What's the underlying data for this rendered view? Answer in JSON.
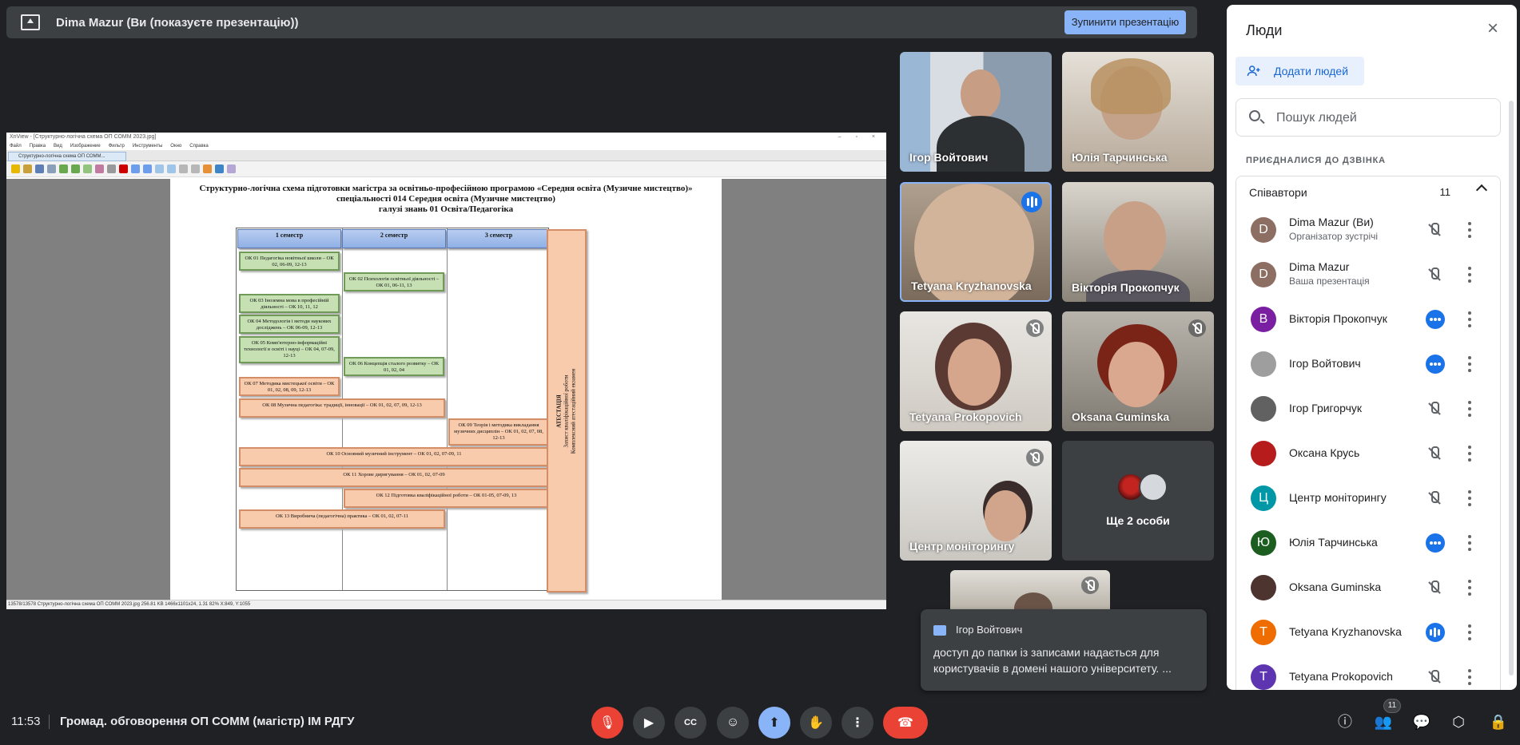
{
  "presenting_bar": {
    "title": "Dima Mazur (Ви (показуєте презентацію))",
    "stop_button": "Зупинити презентацію"
  },
  "shared_screen": {
    "window_title": "XnView - [Структурно-логічна схема ОП СОММ 2023.jpg]",
    "menu": [
      "Файл",
      "Правка",
      "Вид",
      "Изображение",
      "Фильтр",
      "Инструменты",
      "Окно",
      "Справка"
    ],
    "tab_label": "Структурно-логічна схема ОП СОММ...",
    "status": "13578/13578   Структурно-логічна схема ОП СОММ 2023.jpg   256.81 KB   1466x1101x24, 1.31   82%   X:849, Y:1055",
    "doc_title_lines": [
      "Структурно-логічна схема підготовки магістра за освітньо-професійною програмою «Середня освіта (Музичне мистецтво)»",
      "спеціальності 014 Середня освіта (Музичне мистецтво)",
      "галузі знань 01 Освіта/Педагогіка"
    ],
    "semesters": [
      "1 семестр",
      "2 семестр",
      "3 семестр"
    ],
    "boxes": [
      {
        "text": "ОК 01 Педагогіка новітньої школи – ОК 02, 06-09, 12-13",
        "color": "g"
      },
      {
        "text": "ОК 02 Психологія освітньої діяльності – ОК 01, 06-11, 13",
        "color": "g"
      },
      {
        "text": "ОК 03 Іноземна мова в професійній діяльності – ОК 10, 11, 12",
        "color": "g"
      },
      {
        "text": "ОК 04 Методологія і методи наукових досліджень – ОК 06-09, 12-13",
        "color": "g"
      },
      {
        "text": "ОК 05 Комп'ютерно-інформаційні технології в освіті і науці – ОК 04, 07-09, 12-13",
        "color": "g"
      },
      {
        "text": "ОК 06 Концепція сталого розвитку – ОК 01, 02, 04",
        "color": "g"
      },
      {
        "text": "ОК 07 Методика мистецької освіти – ОК 01, 02, 08, 09, 12-13",
        "color": "o"
      },
      {
        "text": "ОК 08 Музична педагогіка: традиції, інновації – ОК 01, 02, 07, 09, 12-13",
        "color": "o"
      },
      {
        "text": "ОК 09 Теорія і методика викладання музичних дисциплін – ОК 01, 02, 07, 08, 12-13",
        "color": "o"
      },
      {
        "text": "ОК 10 Основний музичний інструмент – ОК 01, 02, 07-09, 11",
        "color": "o"
      },
      {
        "text": "ОК 11 Хорове диригування – ОК 01, 02, 07-09",
        "color": "o"
      },
      {
        "text": "ОК 12 Підготовка кваліфікаційної роботи – ОК 01-05, 07-09, 13",
        "color": "o"
      },
      {
        "text": "ОК 13 Виробнича (педагогічна) практика – ОК 01, 02, 07-11",
        "color": "o"
      }
    ],
    "attestation": [
      "АТЕСТАЦІЯ",
      "Захист кваліфікаційної роботи",
      "Комплексний атестаційний екзамен"
    ]
  },
  "tiles": [
    {
      "name": "Ігор Войтович",
      "status": "none"
    },
    {
      "name": "Юлія Тарчинська",
      "status": "none"
    },
    {
      "name": "Tetyana Kryzhanovska",
      "status": "speaking"
    },
    {
      "name": "Вікторія Прокопчук",
      "status": "none"
    },
    {
      "name": "Tetyana Prokopovich",
      "status": "muted"
    },
    {
      "name": "Oksana Guminska",
      "status": "muted"
    },
    {
      "name": "Центр моніторингу",
      "status": "muted"
    },
    {
      "name": "Ще 2 особи",
      "status": "more"
    }
  ],
  "chat_toast": {
    "sender": "Ігор Войтович",
    "message": "доступ до папки із записами надається для користувачів в домені нашого університету. ..."
  },
  "bottom_bar": {
    "time": "11:53",
    "meeting_name": "Громад. обговорення ОП СОММ (магістр) ІМ РДГУ",
    "people_count": "11"
  },
  "people_panel": {
    "title": "Люди",
    "add_people": "Додати людей",
    "search_placeholder": "Пошук людей",
    "section_label": "ПРИЄДНАЛИСЯ ДО ДЗВІНКА",
    "group_name": "Співавтори",
    "group_count": "11",
    "participants": [
      {
        "initial": "D",
        "name": "Dima Mazur (Ви)",
        "sub": "Організатор зустрічі",
        "mic": "muted",
        "avatar_color": "#8d6e63"
      },
      {
        "initial": "D",
        "name": "Dima Mazur",
        "sub": "Ваша презентація",
        "mic": "muted",
        "avatar_color": "#8d6e63"
      },
      {
        "initial": "В",
        "name": "Вікторія Прокопчук",
        "sub": "",
        "mic": "active",
        "avatar_color": "#7b1fa2"
      },
      {
        "initial": "",
        "name": "Ігор Войтович",
        "sub": "",
        "mic": "active",
        "avatar_color": "#9e9e9e"
      },
      {
        "initial": "",
        "name": "Ігор Григорчук",
        "sub": "",
        "mic": "muted",
        "avatar_color": "#616161"
      },
      {
        "initial": "",
        "name": "Оксана Крусь",
        "sub": "",
        "mic": "muted",
        "avatar_color": "#b71c1c"
      },
      {
        "initial": "Ц",
        "name": "Центр моніторингу",
        "sub": "",
        "mic": "muted",
        "avatar_color": "#0097a7"
      },
      {
        "initial": "Ю",
        "name": "Юлія Тарчинська",
        "sub": "",
        "mic": "active",
        "avatar_color": "#1b5e20"
      },
      {
        "initial": "",
        "name": "Oksana Guminska",
        "sub": "",
        "mic": "muted",
        "avatar_color": "#4e342e"
      },
      {
        "initial": "T",
        "name": "Tetyana Kryzhanovska",
        "sub": "",
        "mic": "speaking",
        "avatar_color": "#ef6c00"
      },
      {
        "initial": "T",
        "name": "Tetyana Prokopovich",
        "sub": "",
        "mic": "muted",
        "avatar_color": "#5e35b1"
      }
    ]
  }
}
